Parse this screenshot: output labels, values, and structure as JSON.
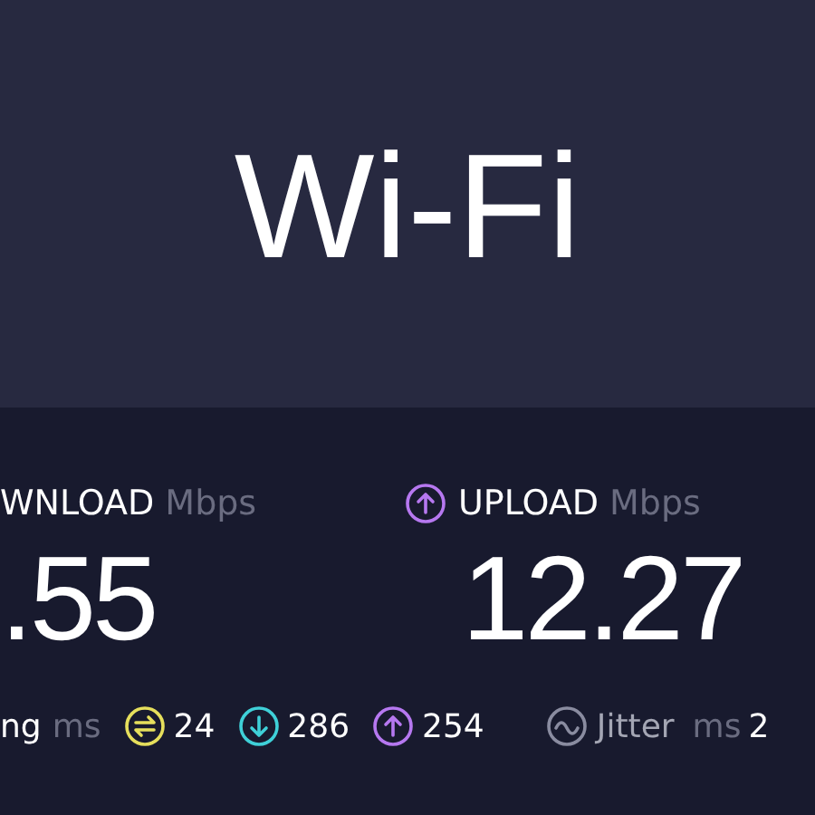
{
  "header": {
    "title": "Wi-Fi"
  },
  "speeds": [
    {
      "kind": "download",
      "label": "WNLOAD",
      "unit": "Mbps",
      "value": ".55"
    },
    {
      "kind": "upload",
      "label": "UPLOAD",
      "unit": "Mbps",
      "value": "12.27"
    }
  ],
  "latency": {
    "label": "ng",
    "unit": "ms",
    "items": [
      {
        "kind": "idle",
        "value": "24"
      },
      {
        "kind": "download",
        "value": "286"
      },
      {
        "kind": "upload",
        "value": "254"
      }
    ]
  },
  "jitter": {
    "label": "Jitter",
    "unit": "ms",
    "value": "2"
  }
}
